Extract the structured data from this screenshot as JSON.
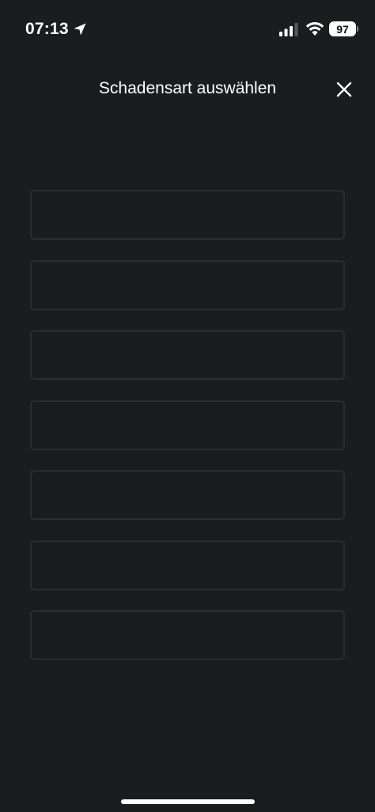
{
  "status_bar": {
    "time": "07:13",
    "battery_level": "97",
    "location_icon": "location-arrow-icon",
    "signal_icon": "cellular-signal-icon",
    "wifi_icon": "wifi-icon"
  },
  "header": {
    "title": "Schadensart auswählen",
    "close_icon": "close-icon"
  },
  "options": [
    {
      "label": ""
    },
    {
      "label": ""
    },
    {
      "label": ""
    },
    {
      "label": ""
    },
    {
      "label": ""
    },
    {
      "label": ""
    },
    {
      "label": ""
    }
  ],
  "colors": {
    "background": "#1b1c1e",
    "card_border": "#2c2d30",
    "text": "#ffffff"
  }
}
